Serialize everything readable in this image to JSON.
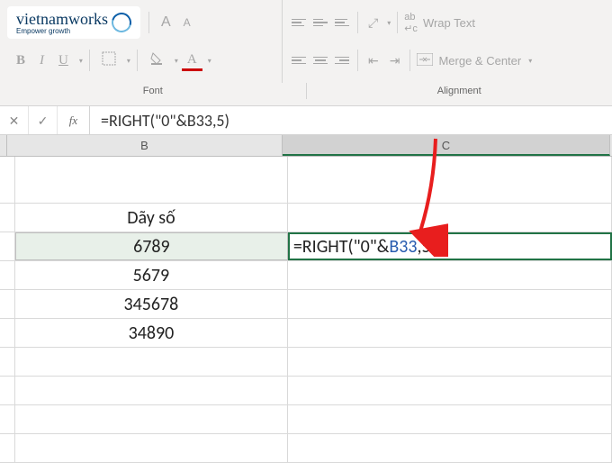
{
  "ribbon": {
    "font_group_label": "Font",
    "alignment_group_label": "Alignment",
    "increase_font": "A",
    "decrease_font": "A",
    "bold": "B",
    "italic": "I",
    "underline": "U",
    "font_color": "A",
    "wrap_text": "Wrap Text",
    "merge_center": "Merge & Center"
  },
  "logo": {
    "brand": "vietnamworks",
    "tagline": "Empower growth"
  },
  "formula_bar": {
    "cancel": "✕",
    "confirm": "✓",
    "fx": "fx",
    "formula": "=RIGHT(\"0\"&B33,5)"
  },
  "columns": {
    "b": "B",
    "c": "C"
  },
  "cells": {
    "header": "Dãy số",
    "b_values": [
      "6789",
      "5679",
      "345678",
      "34890"
    ],
    "c_formula_prefix": "=RIGHT(\"0\"&",
    "c_formula_ref": "B33",
    "c_formula_suffix": ",5)"
  }
}
